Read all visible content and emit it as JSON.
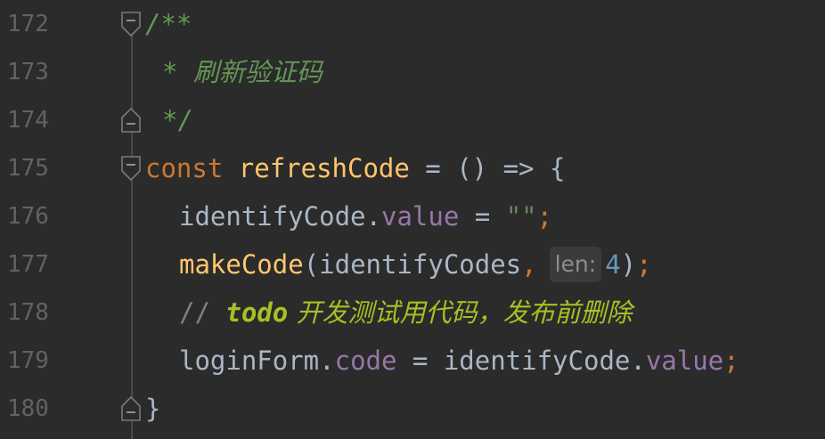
{
  "lines": [
    {
      "number": "172",
      "doc_open": "/**"
    },
    {
      "number": "173",
      "doc_star": "* ",
      "doc_text": "刷新验证码"
    },
    {
      "number": "174",
      "doc_close": "*/"
    },
    {
      "number": "175",
      "kw_const": "const",
      "fn_name": "refreshCode",
      "rest": " = () => {"
    },
    {
      "number": "176",
      "obj": "identifyCode",
      "dot": ".",
      "prop": "value",
      "eq": " = ",
      "str": "\"\"",
      "semi": ";"
    },
    {
      "number": "177",
      "fn_name": "makeCode",
      "args": "(identifyCodes",
      "comma": ",",
      "hint": "len:",
      "num": "4",
      "close": ")",
      "semi": ";"
    },
    {
      "number": "178",
      "slashes": "// ",
      "todo": "todo",
      "todo_text": " 开发测试用代码，发布前删除"
    },
    {
      "number": "179",
      "obj": "loginForm",
      "dot": ".",
      "prop": "code",
      "eq": " = ",
      "obj2": "identifyCode",
      "dot2": ".",
      "prop2": "value",
      "semi": ";"
    },
    {
      "number": "180",
      "brace": "}"
    }
  ],
  "colors": {
    "background": "#2b2b2b",
    "line_number": "#606366",
    "keyword": "#cc7832",
    "function": "#ffc66d",
    "identifier": "#a9b7c6",
    "property": "#9876aa",
    "string": "#6a8759",
    "number": "#6897bb",
    "doc_comment": "#629755",
    "todo": "#a8c023"
  },
  "icons": {
    "fold_open": "fold-open-icon",
    "fold_close": "fold-close-icon"
  }
}
